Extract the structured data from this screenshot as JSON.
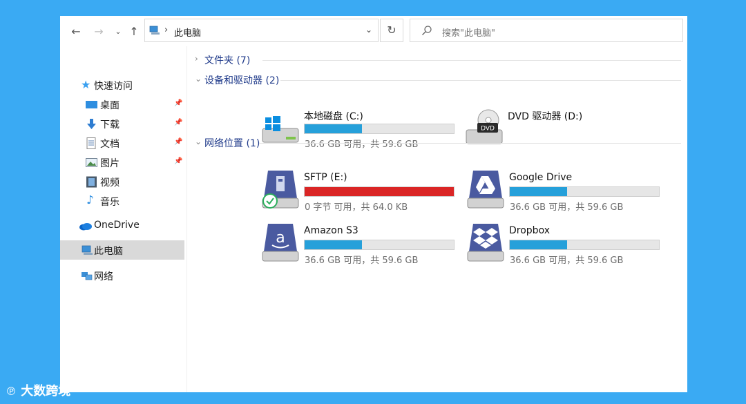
{
  "toolbar": {
    "back_icon": "arrow-left-icon",
    "forward_icon": "arrow-right-icon",
    "recent_icon": "chevron-down-icon",
    "up_icon": "arrow-up-icon",
    "address": {
      "separator": "›",
      "path": "此电脑"
    },
    "refresh_icon": "refresh-icon",
    "search_placeholder": "搜索\"此电脑\""
  },
  "sidebar": {
    "quick_access": "快速访问",
    "items": [
      {
        "label": "桌面",
        "pinned": true,
        "icon": "desktop-icon"
      },
      {
        "label": "下载",
        "pinned": true,
        "icon": "download-icon"
      },
      {
        "label": "文档",
        "pinned": true,
        "icon": "document-icon"
      },
      {
        "label": "图片",
        "pinned": true,
        "icon": "pictures-icon"
      },
      {
        "label": "视频",
        "pinned": false,
        "icon": "video-icon"
      },
      {
        "label": "音乐",
        "pinned": false,
        "icon": "music-icon"
      }
    ],
    "onedrive": "OneDrive",
    "this_pc": "此电脑",
    "network": "网络"
  },
  "main": {
    "sections": {
      "folders": "文件夹 (7)",
      "devices": "设备和驱动器 (2)",
      "network": "网络位置 (1)"
    },
    "drives": [
      {
        "name": "本地磁盘 (C:)",
        "size": "36.6 GB 可用，共 59.6 GB",
        "used": 0.386,
        "icon": "windows-drive-icon"
      },
      {
        "name": "DVD 驱动器 (D:)",
        "size": "",
        "used": null,
        "icon": "dvd-drive-icon"
      }
    ],
    "network_locations": [
      {
        "name": "SFTP (E:)",
        "size": "0 字节 可用，共 64.0 KB",
        "used": 1.0,
        "icon": "sftp-drive-icon"
      },
      {
        "name": "Google Drive",
        "size": "36.6 GB 可用，共 59.6 GB",
        "used": 0.386,
        "icon": "google-drive-icon"
      },
      {
        "name": "Amazon S3",
        "size": "36.6 GB 可用，共 59.6 GB",
        "used": 0.386,
        "icon": "amazon-s3-icon"
      },
      {
        "name": "Dropbox",
        "size": "36.6 GB 可用，共 59.6 GB",
        "used": 0.386,
        "icon": "dropbox-icon"
      }
    ]
  },
  "watermark": "大数跨境",
  "colors": {
    "accent": "#26a0da",
    "danger": "#da2626",
    "background": "#3aaaf3"
  }
}
